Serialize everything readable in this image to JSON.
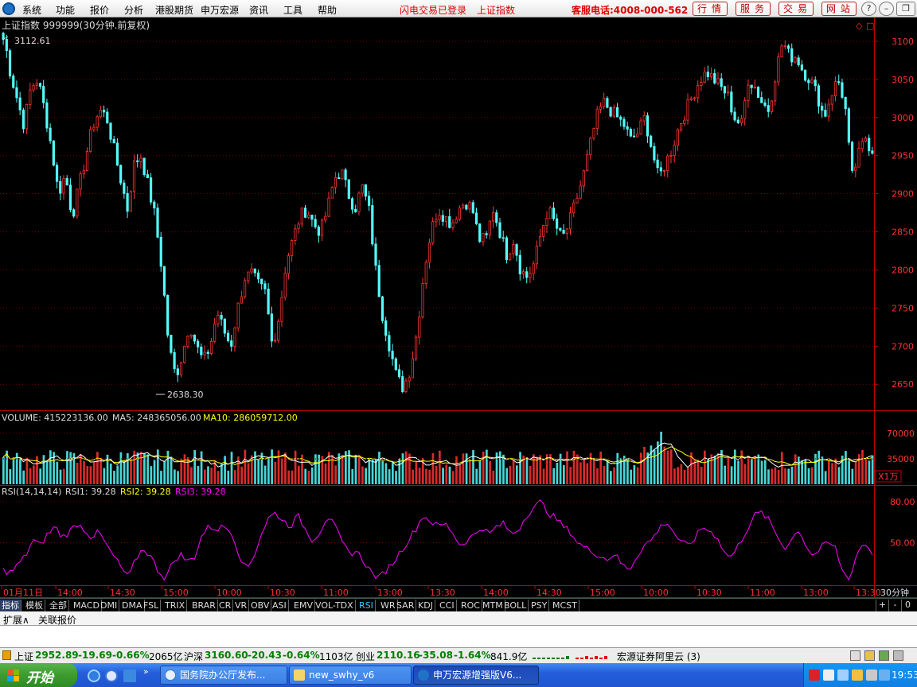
{
  "menu": {
    "items": [
      "系统",
      "功能",
      "报价",
      "分析",
      "港股期货",
      "申万宏源",
      "资讯",
      "工具",
      "帮助"
    ],
    "flash_status": "闪电交易已登录",
    "current_index": "上证指数",
    "hotline": "客服电话:4008-000-562",
    "tabs": [
      "行情",
      "服务",
      "交易",
      "网站"
    ],
    "window_buttons": [
      "?",
      "–",
      "❐",
      "✕"
    ]
  },
  "chart_header": {
    "title": "上证指数 999999(30分钟.前复权)",
    "high_label": "3112.61",
    "low_label": "2638.30",
    "top_right_icons": [
      "◇",
      "□"
    ]
  },
  "price_axis": [
    "3100",
    "3050",
    "3000",
    "2950",
    "2900",
    "2850",
    "2800",
    "2750",
    "2700",
    "2650"
  ],
  "volume_panel": {
    "label": "VOLUME: 415223136.00",
    "ma5": "MA5: 248365056.00",
    "ma10": "MA10: 286059712.00",
    "axis": [
      "70000",
      "35000"
    ],
    "unit": "X1万"
  },
  "rsi_panel": {
    "label": "RSI(14,14,14)",
    "rsi1": "RSI1: 39.28",
    "rsi2": "RSI2: 39.28",
    "rsi3": "RSI3: 39.28",
    "axis": [
      "80.00",
      "50.00"
    ]
  },
  "time_axis": {
    "labels": [
      "01月11日",
      "14:00",
      "14:30",
      "15:00",
      "10:00",
      "10:30",
      "11:00",
      "13:00",
      "13:30",
      "14:00",
      "14:30",
      "15:00",
      "10:00",
      "10:30",
      "11:00",
      "13:00",
      "13:30"
    ],
    "period": "30分钟"
  },
  "indicator_tabs": [
    "指标",
    "模板",
    "全部",
    "MACD",
    "DMI",
    "DMA",
    "FSL",
    "TRIX",
    "BRAR",
    "CR",
    "VR",
    "OBV",
    "ASI",
    "EMV",
    "VOL-TDX",
    "RSI",
    "WR",
    "SAR",
    "KDJ",
    "CCI",
    "ROC",
    "MTM",
    "BOLL",
    "PSY",
    "MCST"
  ],
  "indicator_active": "RSI",
  "indicator_controls": [
    "+",
    "-",
    "0"
  ],
  "ext_tabs": [
    "扩展∧",
    "关联报价"
  ],
  "status_bar": {
    "sh_name": "上证",
    "sh_value": "2952.89",
    "sh_change": "-19.69",
    "sh_pct": "-0.66%",
    "sh_amount": "2065亿",
    "hs_name": "沪深",
    "hs_value": "3160.60",
    "hs_change": "-20.43",
    "hs_pct": "-0.64%",
    "hs_amount": "1103亿",
    "cy_name": "创业",
    "cy_value": "2110.16",
    "cy_change": "-35.08",
    "cy_pct": "-1.64%",
    "cy_amount": "841.9亿",
    "broker": "宏源证券阿里云 (3)"
  },
  "taskbar": {
    "start": "开始",
    "tasks": [
      "国务院办公厅发布...",
      "new_swhy_v6",
      "申万宏源增强版V6..."
    ],
    "clock": "19:53"
  },
  "colors": {
    "up": "#ff3232",
    "down": "#54fcfc",
    "grid": "#7a0000",
    "axis": "#c00000",
    "ma10": "#ffff00",
    "rsi": "#ff00ff"
  },
  "chart_data": {
    "type": "candlestick",
    "title": "上证指数 999999(30分钟.前复权)",
    "y_range": [
      2620,
      3125
    ],
    "high": 3112.61,
    "low": 2638.3,
    "close_path": [
      3112,
      3060,
      3025,
      2990,
      3040,
      3050,
      3010,
      2960,
      2900,
      2925,
      2870,
      2910,
      2950,
      2990,
      3010,
      3000,
      2960,
      2920,
      2880,
      2940,
      2950,
      2910,
      2870,
      2800,
      2700,
      2660,
      2690,
      2730,
      2700,
      2680,
      2700,
      2745,
      2720,
      2700,
      2750,
      2790,
      2795,
      2780,
      2770,
      2700,
      2740,
      2810,
      2840,
      2870,
      2880,
      2860,
      2850,
      2880,
      2920,
      2930,
      2900,
      2880,
      2910,
      2880,
      2800,
      2740,
      2700,
      2660,
      2645,
      2670,
      2720,
      2800,
      2850,
      2880,
      2870,
      2860,
      2880,
      2890,
      2880,
      2840,
      2840,
      2880,
      2850,
      2820,
      2840,
      2800,
      2790,
      2810,
      2850,
      2880,
      2860,
      2840,
      2860,
      2890,
      2920,
      2960,
      3000,
      3020,
      3010,
      3000,
      2990,
      2970,
      2980,
      3000,
      2960,
      2920,
      2940,
      2960,
      2990,
      3010,
      3030,
      3050,
      3060,
      3050,
      3040,
      3030,
      3000,
      2990,
      3050,
      3040,
      3020,
      3010,
      3060,
      3100,
      3080,
      3080,
      3060,
      3050,
      3030,
      3000,
      3030,
      3050,
      3020,
      2920,
      2950,
      2975,
      2953
    ],
    "rsi_range": [
      20,
      90
    ],
    "rsi_path": [
      30,
      28,
      34,
      40,
      52,
      48,
      56,
      62,
      54,
      58,
      64,
      60,
      54,
      58,
      48,
      40,
      32,
      24,
      38,
      46,
      40,
      30,
      24,
      35,
      42,
      36,
      40,
      56,
      62,
      60,
      62,
      58,
      42,
      30,
      40,
      56,
      68,
      72,
      66,
      62,
      70,
      60,
      52,
      58,
      70,
      62,
      50,
      42,
      44,
      36,
      28,
      24,
      30,
      36,
      44,
      52,
      60,
      70,
      66,
      62,
      64,
      58,
      48,
      52,
      56,
      62,
      56,
      62,
      64,
      56,
      60,
      70,
      76,
      80,
      72,
      68,
      62,
      58,
      50,
      46,
      44,
      40,
      38,
      42,
      34,
      30,
      40,
      48,
      52,
      60,
      66,
      58,
      50,
      48,
      54,
      62,
      58,
      54,
      42,
      40,
      50,
      60,
      70,
      72,
      66,
      56,
      46,
      52,
      60,
      48,
      40,
      46,
      50,
      46,
      28,
      24,
      44,
      50,
      42
    ]
  }
}
